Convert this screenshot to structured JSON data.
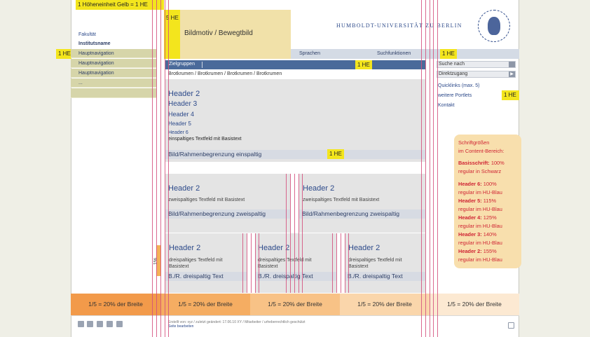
{
  "annotations": {
    "top_label": "1 Höheneinheit Gelb = 1 HE",
    "he5": "5 HE",
    "he1_nav": "1 HE",
    "he1_zielgruppen": "1 HE",
    "he1_sprachen": "1 HE",
    "he1_portlets": "1 HE",
    "he1_bild": "1 HE",
    "one_percent": "1%"
  },
  "header": {
    "bildmotiv": "Bildmotiv / Bewegtbild",
    "university": "HUMBOLDT-UNIVERSITÄT ZU BERLIN"
  },
  "sidebar": {
    "fakultaet": "Fakultät",
    "institut": "Institutsname",
    "items": [
      "Hauptnavigation",
      "Hauptnavigation",
      "Hauptnavigation",
      "..."
    ]
  },
  "topbar": {
    "sprachen": "Sprachen",
    "suchfunktionen": "Suchfunktionen"
  },
  "content": {
    "zielgruppen": "Zielgruppen",
    "breadcrumb": "Brotkrumen / Brotkrumen / Brotkrumen / Brotkrumen",
    "h2": "Header 2",
    "h3": "Header 3",
    "h4": "Header 4",
    "h5": "Header 5",
    "h6": "Header 6",
    "textfield_one": "einspaltiges Textfeld mit Basistext",
    "bild_one": "Bild/Rahmenbegrenzung einspaltig",
    "two_col": [
      {
        "header": "Header 2",
        "text": "zweispaltiges Textfeld mit Basistext",
        "bild": "Bild/Rahmenbegrenzung zweispaltig"
      },
      {
        "header": "Header 2",
        "text": "zweispaltiges Textfeld mit Basistext",
        "bild": "Bild/Rahmenbegrenzung zweispaltig"
      }
    ],
    "three_col": [
      {
        "header": "Header 2",
        "text": "dreispaltiges Textfeld mit Basistext",
        "bild": "B./R. dreispaltig Text"
      },
      {
        "header": "Header 2",
        "text": "dreispaltiges Textfeld mit Basistext",
        "bild": "B./R. dreispaltig Text"
      },
      {
        "header": "Header 2",
        "text": "dreispaltiges Textfeld mit Basistext",
        "bild": "B./R. dreispaltig Text"
      }
    ]
  },
  "rightcol": {
    "search_placeholder": "Suche nach",
    "direktzugang": "Direktzugang",
    "quicklinks": "Quicklinks (max. 5)",
    "portlets": "weitere Portlets",
    "kontakt": "Kontakt"
  },
  "fontinfo": {
    "title1": "Schriftgrößen",
    "title2": "im Content-Bereich:",
    "basis_b": "Basisschrift:",
    "basis_v": " 100%",
    "basis_s": "regular in Schwarz",
    "h6_b": "Header 6:",
    "h6_v": " 100%",
    "h6_s": "regular im HU-Blau",
    "h5_b": "Header 5:",
    "h5_v": " 115%",
    "h5_s": "regular im HU-Blau",
    "h4_b": "Header 4:",
    "h4_v": " 125%",
    "h4_s": "regular im HU-Blau",
    "h3_b": "Header 3:",
    "h3_v": " 140%",
    "h3_s": "regular im HU-Blau",
    "h2_b": "Header 2:",
    "h2_v": " 155%",
    "h2_s": "regular im HU-Blau"
  },
  "footer_cols": [
    "1/5 = 20% der Breite",
    "1/5 = 20% der Breite",
    "1/5 = 20% der Breite",
    "1/5 = 20% der Breite",
    "1/5 = 20% der Breite"
  ],
  "footer": {
    "meta": "Erstellt von: xyz / zuletzt geändert: 17.06.10 XY / Mitarbeiter / urheberrechtlich geschützt",
    "bearbeiten": "Seite bearbeiten"
  },
  "colors": {
    "footer_shades": [
      "#f29a4a",
      "#f5ad62",
      "#f8c286",
      "#fad6ab",
      "#fce9d2"
    ]
  },
  "icons": [
    "twitter-icon",
    "facebook-icon",
    "rss-icon",
    "delicious-icon",
    "youtube-icon",
    "print-icon"
  ]
}
